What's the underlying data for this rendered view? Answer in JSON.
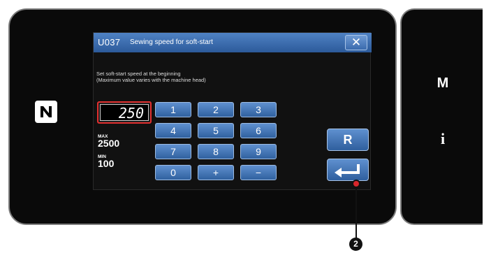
{
  "dialog": {
    "code": "U037",
    "title": "Sewing speed for soft-start",
    "close_label": "✕",
    "description": [
      "Set soft-start speed at the beginning",
      "(Maximum value varies with the machine head)"
    ],
    "value": "250",
    "max_label": "MAX",
    "max_value": "2500",
    "min_label": "MIN",
    "min_value": "100"
  },
  "keypad": {
    "keys": [
      "1",
      "2",
      "3",
      "4",
      "5",
      "6",
      "7",
      "8",
      "9",
      "0",
      "+",
      "−"
    ]
  },
  "buttons": {
    "reset_label": "R",
    "enter_icon": "enter-arrow-icon"
  },
  "side": {
    "mode_label": "M",
    "info_label": "i"
  },
  "annotation": {
    "callout_number": "2"
  },
  "colors": {
    "button_blue": "#4a7cc0",
    "highlight_red": "#e23030",
    "panel_black": "#0a0a0a"
  }
}
